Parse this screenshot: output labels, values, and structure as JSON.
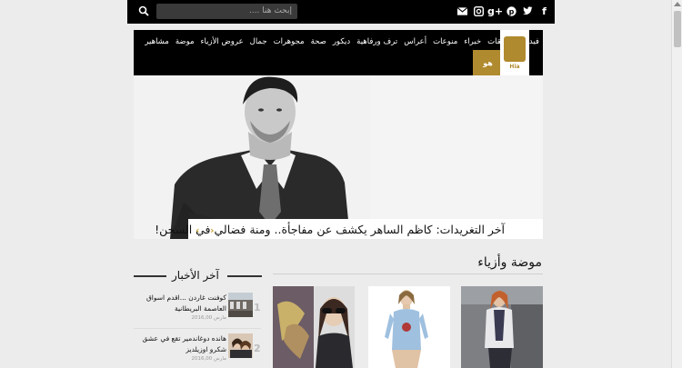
{
  "topbar": {
    "search_placeholder": "إبحث هنا ....",
    "social_icons": [
      "facebook-icon",
      "twitter-icon",
      "pinterest-icon",
      "google-plus-icon",
      "instagram-icon",
      "mail-icon"
    ],
    "social_glyphs": [
      "f",
      "t",
      "p",
      "g+",
      "◙",
      "✉"
    ]
  },
  "nav": {
    "items": [
      "مشاهير",
      "موضة",
      "عروض الأزياء",
      "جمال",
      "مجوهرات",
      "صحة",
      "ديكور",
      "ترف ورفاهية",
      "أعراس",
      "منوعات",
      "خبراء",
      "مسابقات",
      "فيديو"
    ]
  },
  "logo": {
    "gold_label": "هو",
    "brand_label": "Hia"
  },
  "hero": {
    "caption": "آخر التغريدات: كاظم الساهر يكشف عن مفاجأة.. ومنة فضالي في السجن!",
    "prev": "‹",
    "next": "›"
  },
  "section": {
    "title": "موضة وأزياء"
  },
  "sidebar": {
    "title": "آخر الأخبار",
    "items": [
      {
        "num": "1",
        "text": "كوفنت غاردن ...اقدم اسواق العاصمة البريطانية",
        "date": "2016,00 مارس"
      },
      {
        "num": "2",
        "text": "هانده دوغاندمير تقع في عشق شكرو اوزيلديز",
        "date": "2016,00 مارس"
      }
    ]
  },
  "colors": {
    "black": "#000000",
    "gold": "#b08a2e",
    "accent_arrow": "#c9a53a",
    "background": "#ececec"
  }
}
